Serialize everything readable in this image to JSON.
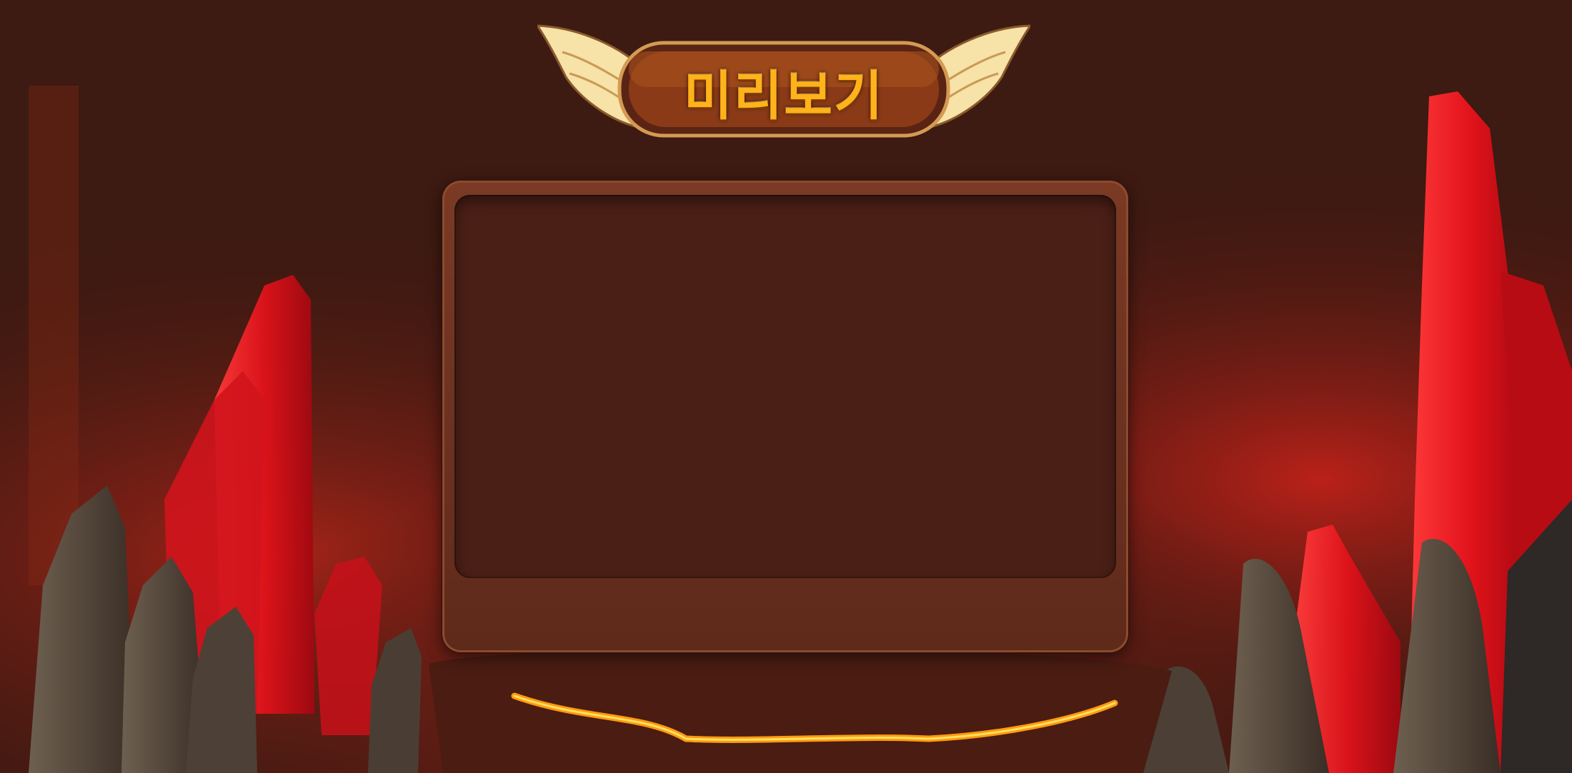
{
  "header": {
    "title": "미리보기"
  },
  "preview_panel": {
    "state": "empty"
  },
  "colors": {
    "background": "#3a1810",
    "panel_frame": "#6a3020",
    "panel_screen": "#4a1f16",
    "title_text": "#ffb21a",
    "crystal": "#e0121a",
    "lava": "#ff9a10"
  },
  "icons": [
    "left-wing-icon",
    "right-wing-icon"
  ]
}
